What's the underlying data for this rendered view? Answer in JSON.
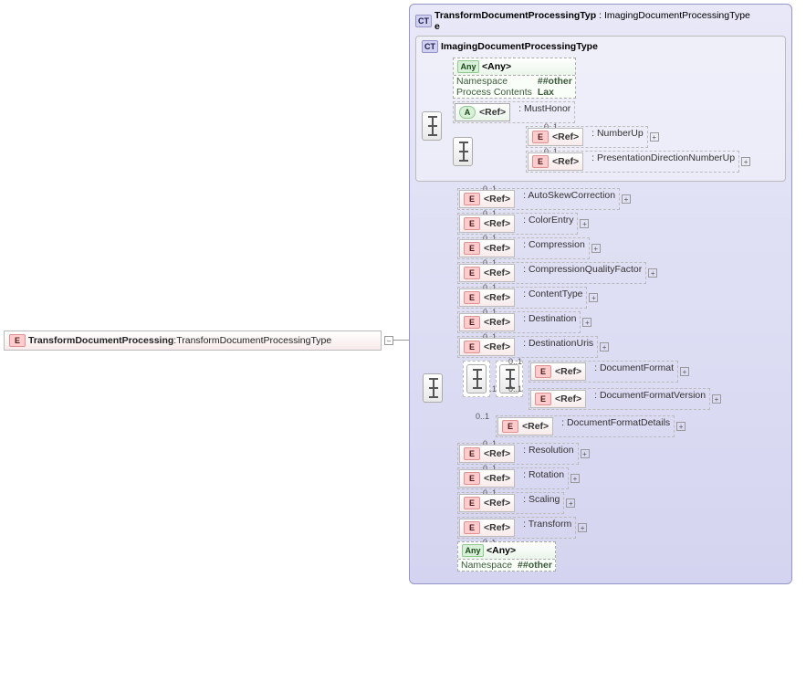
{
  "root": {
    "badge": "E",
    "name": "TransformDocumentProcessing",
    "type": "TransformDocumentProcessingType"
  },
  "ct": {
    "badge": "CT",
    "name": "TransformDocumentProcessingTyp",
    "name2": "e",
    "baseType": "ImagingDocumentProcessingType",
    "inner": {
      "badge": "CT",
      "name": "ImagingDocumentProcessingType",
      "any": {
        "badge": "Any",
        "label": "<Any>",
        "ns_lbl": "Namespace",
        "ns_val": "##other",
        "pc_lbl": "Process Contents",
        "pc_val": "Lax"
      },
      "mustHonor": {
        "badge": "A",
        "ref": "<Ref>",
        "name": "MustHonor"
      },
      "numberUp": {
        "badge": "E",
        "ref": "<Ref>",
        "name": "NumberUp",
        "card": "0..1"
      },
      "presDir": {
        "badge": "E",
        "ref": "<Ref>",
        "name": "PresentationDirectionNumberUp",
        "card": "0..1"
      }
    },
    "ext": {
      "autoSkew": {
        "badge": "E",
        "ref": "<Ref>",
        "name": "AutoSkewCorrection",
        "card": "0..1"
      },
      "colorEntry": {
        "badge": "E",
        "ref": "<Ref>",
        "name": "ColorEntry",
        "card": "0..1"
      },
      "compression": {
        "badge": "E",
        "ref": "<Ref>",
        "name": "Compression",
        "card": "0..1"
      },
      "cqf": {
        "badge": "E",
        "ref": "<Ref>",
        "name": "CompressionQualityFactor",
        "card": "0..1"
      },
      "contentType": {
        "badge": "E",
        "ref": "<Ref>",
        "name": "ContentType",
        "card": "0..1"
      },
      "destination": {
        "badge": "E",
        "ref": "<Ref>",
        "name": "Destination",
        "card": "0..1"
      },
      "destinationUris": {
        "badge": "E",
        "ref": "<Ref>",
        "name": "DestinationUris",
        "card": "0..1"
      },
      "docFormat": {
        "badge": "E",
        "ref": "<Ref>",
        "name": "DocumentFormat",
        "card": "0..1"
      },
      "docFormatVersion": {
        "badge": "E",
        "ref": "<Ref>",
        "name": "DocumentFormatVersion",
        "card": "0..1"
      },
      "docFormatDetails": {
        "badge": "E",
        "ref": "<Ref>",
        "name": "DocumentFormatDetails",
        "card": "0..1"
      },
      "dfGroupCard": "0..1",
      "resolution": {
        "badge": "E",
        "ref": "<Ref>",
        "name": "Resolution",
        "card": "0..1"
      },
      "rotation": {
        "badge": "E",
        "ref": "<Ref>",
        "name": "Rotation",
        "card": "0..1"
      },
      "scaling": {
        "badge": "E",
        "ref": "<Ref>",
        "name": "Scaling",
        "card": "0..1"
      },
      "transform": {
        "badge": "E",
        "ref": "<Ref>",
        "name": "Transform"
      },
      "anyExt": {
        "badge": "Any",
        "label": "<Any>",
        "ns_lbl": "Namespace",
        "ns_val": "##other",
        "card": "0..*"
      }
    }
  }
}
